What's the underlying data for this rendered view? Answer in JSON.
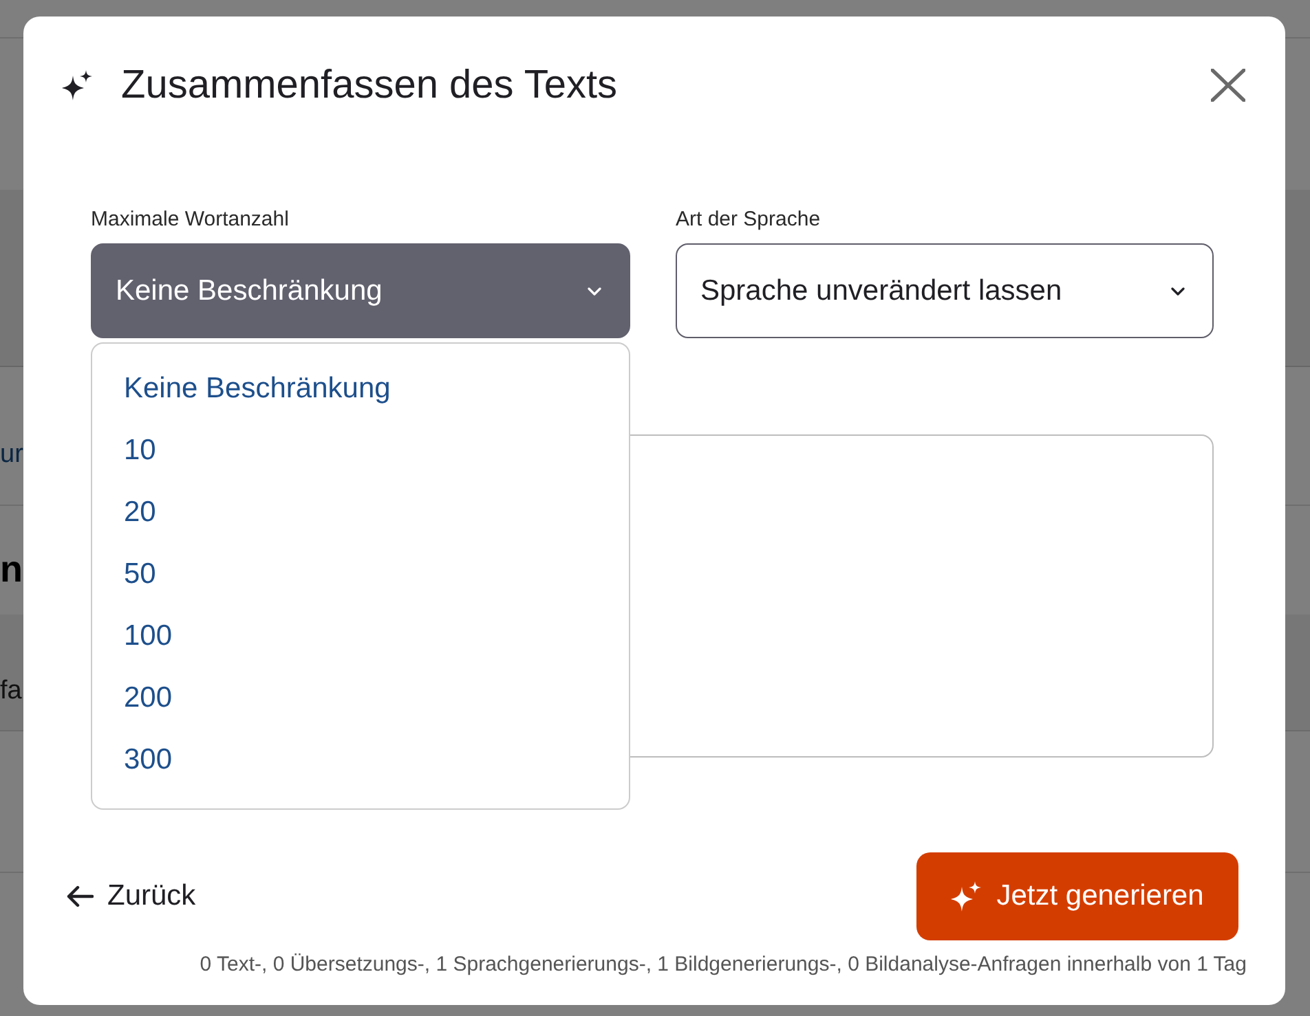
{
  "background_page": {
    "link_fragment": "ur",
    "heading_fragment": "n",
    "tab_fragment": "fa"
  },
  "dialog": {
    "title": "Zusammenfassen des Texts",
    "fields": [
      {
        "kind": "select",
        "label": "Maximale Wortanzahl",
        "value": "Keine Beschränkung",
        "expanded": true,
        "options": [
          "Keine Beschränkung",
          "10",
          "20",
          "50",
          "100",
          "200",
          "300"
        ]
      },
      {
        "kind": "select",
        "label": "Art der Sprache",
        "value": "Sprache unverändert lassen",
        "expanded": false
      },
      {
        "kind": "textarea"
      }
    ],
    "back_link": "Zurück",
    "generate_button": "Jetzt generieren",
    "quota_note": "0 Text-, 0 Übersetzungs-, 1 Sprachgenerierungs-, 1 Bildgenerierungs-, 0 Bildanalyse-Anfragen innerhalb von 1 Tag"
  }
}
